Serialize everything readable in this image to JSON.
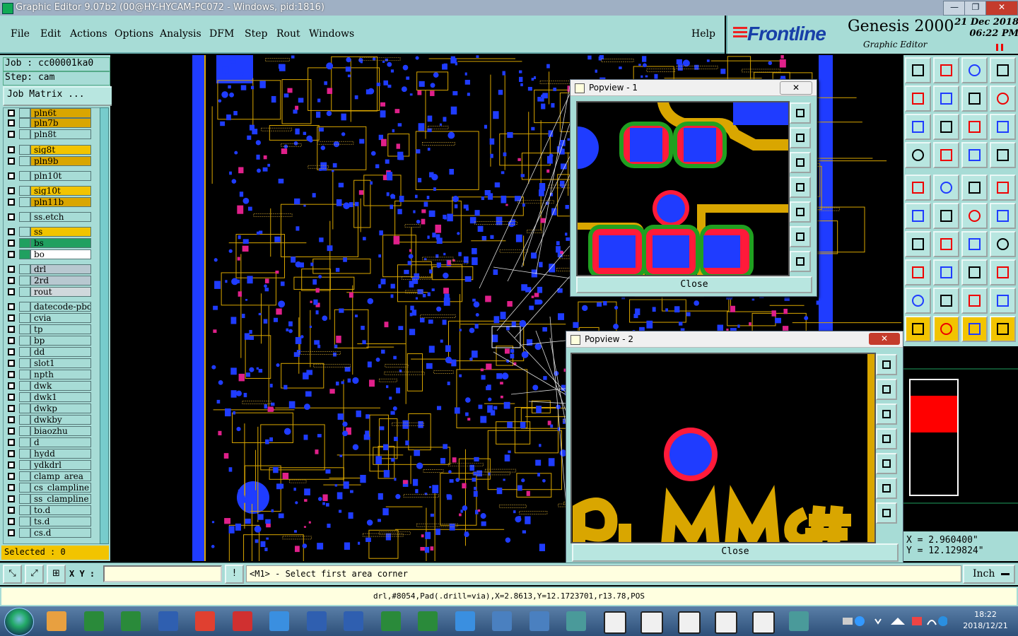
{
  "window": {
    "title": "Graphic Editor 9.07b2 (00@HY-HYCAM-PC072 - Windows, pid:1816)",
    "minimize": "—",
    "maximize": "❐",
    "close": "✕"
  },
  "menu": [
    "File",
    "Edit",
    "Actions",
    "Options",
    "Analysis",
    "DFM",
    "Step",
    "Rout",
    "Windows"
  ],
  "help": "Help",
  "branding": {
    "logo_text": "Frontline",
    "product": "Genesis 2000",
    "subtitle": "Graphic Editor",
    "date": "21 Dec 2018",
    "time": "06:22 PM"
  },
  "job": {
    "job_label": "Job : cc00001ka0",
    "step_label": "Step: cam",
    "matrix_button": "Job Matrix ..."
  },
  "layers": [
    {
      "name": "pln6t",
      "color": "#d9a600"
    },
    {
      "name": "pln7b",
      "color": "#d9a600"
    },
    {
      "name": "pln8t",
      "color": "#a7dcd6"
    },
    {
      "name": "sig8t",
      "color": "#f2c400"
    },
    {
      "name": "pln9b",
      "color": "#d9a600"
    },
    {
      "name": "pln10t",
      "color": "#a7dcd6"
    },
    {
      "name": "sig10t",
      "color": "#f2c400"
    },
    {
      "name": "pln11b",
      "color": "#d9a600"
    },
    {
      "name": "ss.etch",
      "color": "#a7dcd6"
    },
    {
      "name": "ss",
      "color": "#f2c400"
    },
    {
      "name": "bs",
      "color": "#20a060"
    },
    {
      "name": "bo",
      "color": "#ffffff"
    },
    {
      "name": "drl",
      "color": "#b8c8d0"
    },
    {
      "name": "2rd",
      "color": "#b8c8d0"
    },
    {
      "name": "rout",
      "color": "#d0d8dc"
    },
    {
      "name": "datecode-pbd",
      "color": "#a7dcd6"
    },
    {
      "name": "cvia",
      "color": "#a7dcd6"
    },
    {
      "name": "tp",
      "color": "#a7dcd6"
    },
    {
      "name": "bp",
      "color": "#a7dcd6"
    },
    {
      "name": "dd",
      "color": "#a7dcd6"
    },
    {
      "name": "slot1",
      "color": "#a7dcd6"
    },
    {
      "name": "npth",
      "color": "#a7dcd6"
    },
    {
      "name": "dwk",
      "color": "#a7dcd6"
    },
    {
      "name": "dwk1",
      "color": "#a7dcd6"
    },
    {
      "name": "dwkp",
      "color": "#a7dcd6"
    },
    {
      "name": "dwkby",
      "color": "#a7dcd6"
    },
    {
      "name": "biaozhu",
      "color": "#a7dcd6"
    },
    {
      "name": "d",
      "color": "#a7dcd6"
    },
    {
      "name": "hydd",
      "color": "#a7dcd6"
    },
    {
      "name": "ydkdrl",
      "color": "#a7dcd6"
    },
    {
      "name": "clamp_area",
      "color": "#a7dcd6"
    },
    {
      "name": "cs_clampline",
      "color": "#a7dcd6"
    },
    {
      "name": "ss_clampline",
      "color": "#a7dcd6"
    },
    {
      "name": "to.d",
      "color": "#a7dcd6"
    },
    {
      "name": "ts.d",
      "color": "#a7dcd6"
    },
    {
      "name": "cs.d",
      "color": "#a7dcd6"
    }
  ],
  "selected": "Selected : 0",
  "popview1": {
    "title": "Popview - 1",
    "close": "Close"
  },
  "popview2": {
    "title": "Popview - 2",
    "close": "Close"
  },
  "coords": {
    "x": "X = 2.960400\"",
    "y": "Y = 12.129824\""
  },
  "command": {
    "xy_label": "X Y :",
    "xy_value": "",
    "bang": "!",
    "prompt": "<M1> - Select first area corner",
    "unit": "Inch"
  },
  "status": "drl,#8054,Pad(.drill=via),X=2.8613,Y=12.1723701,r13.78,POS",
  "taskbar": {
    "time": "18:22",
    "date": "2018/12/21"
  },
  "colors": {
    "panel": "#a7dcd6",
    "copper": "#d9a600",
    "pad": "#1f3cff",
    "via_ring": "#ff1a3a",
    "board": "#000000"
  }
}
